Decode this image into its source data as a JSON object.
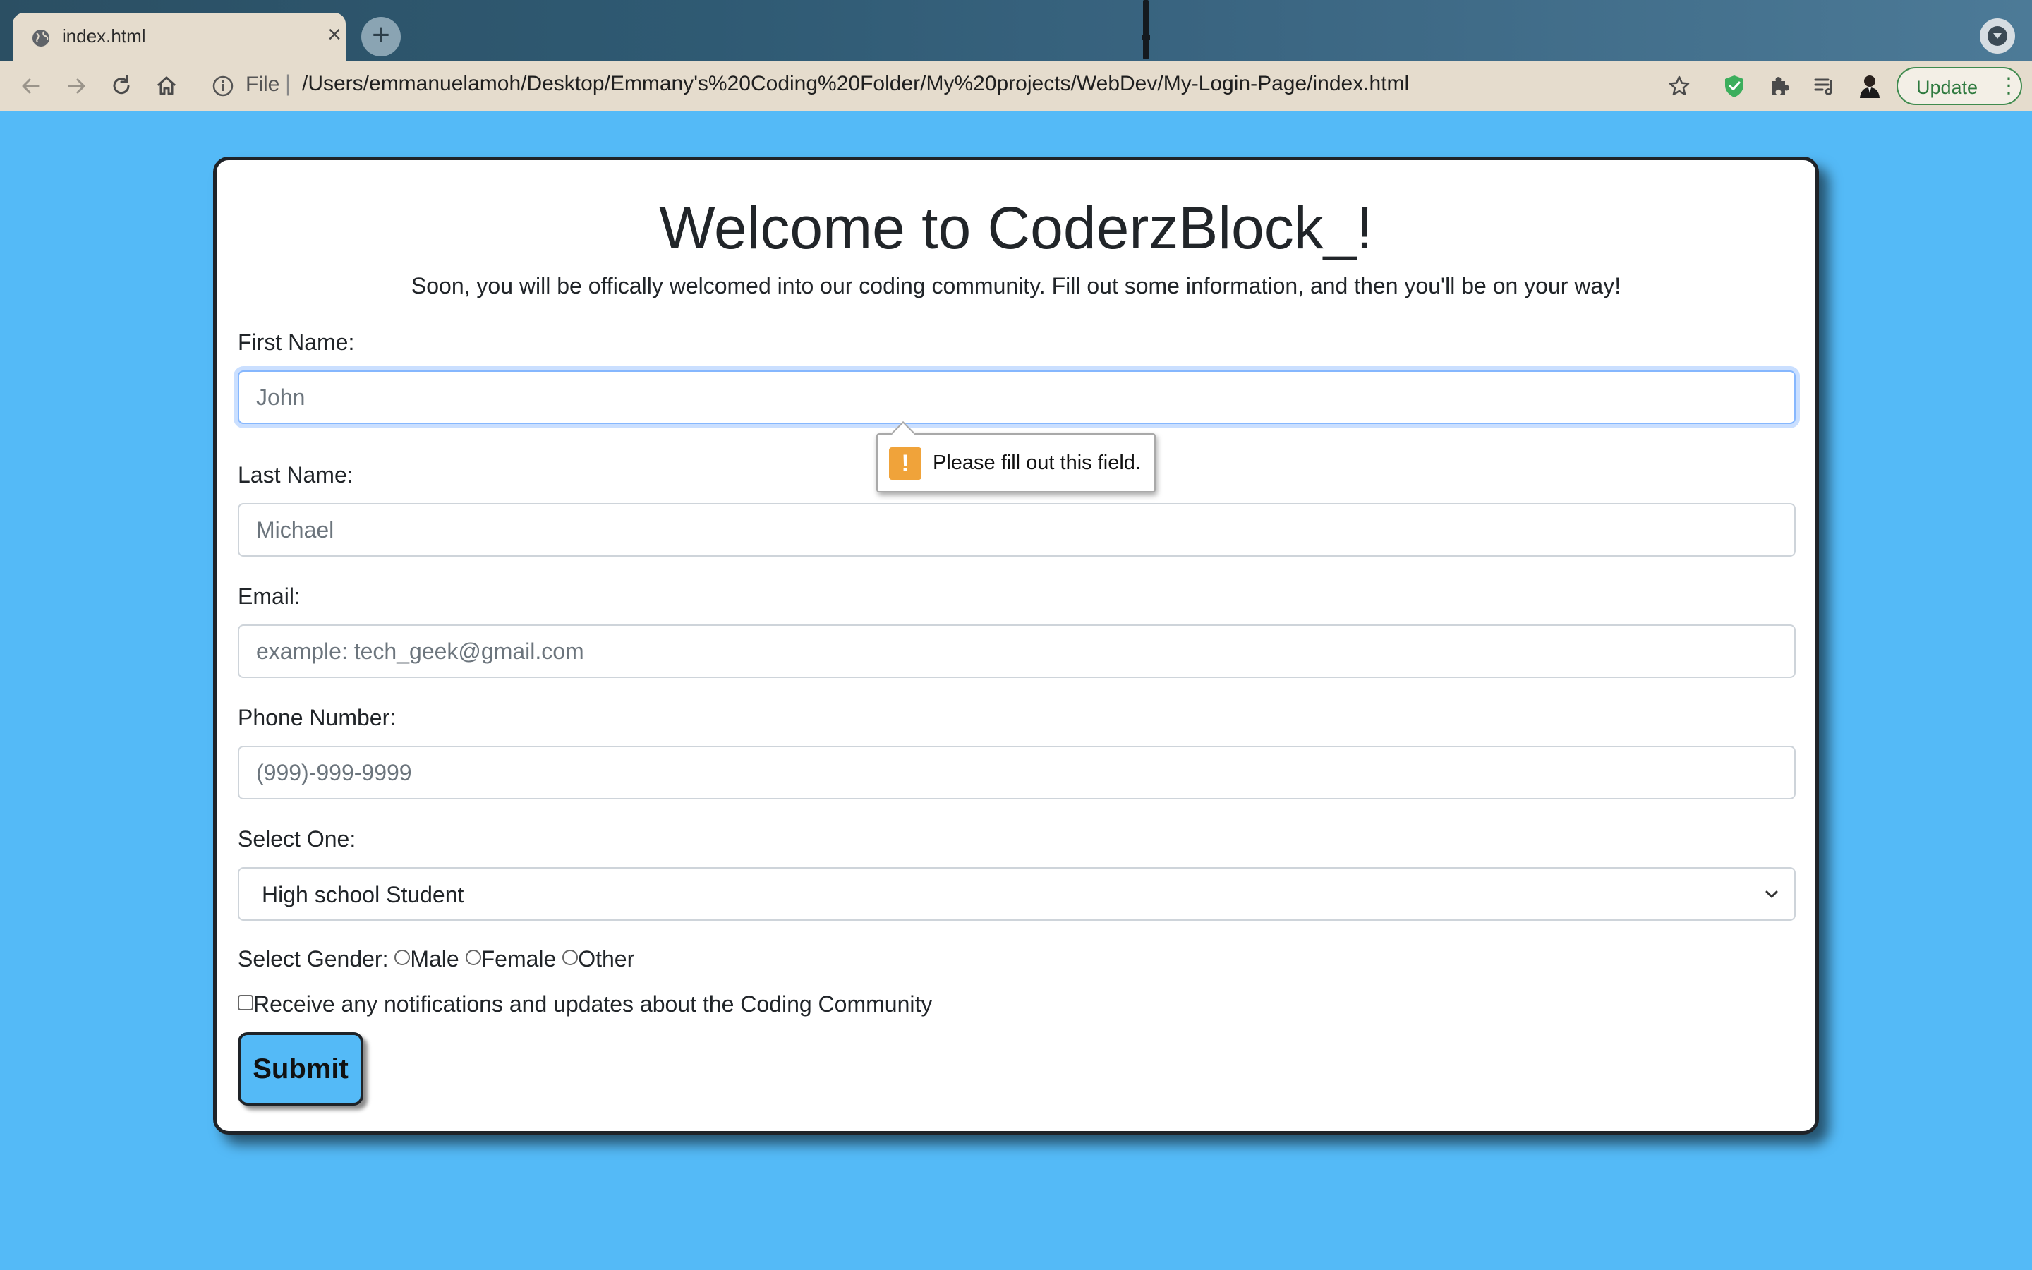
{
  "browser": {
    "tab": {
      "title": "index.html",
      "close_glyph": "×",
      "favicon": "globe-icon"
    },
    "new_tab_glyph": "+",
    "address": {
      "scheme": "File",
      "separator": "|",
      "url": "/Users/emmanuelamoh/Desktop/Emmany's%20Coding%20Folder/My%20projects/WebDev/My-Login-Page/index.html"
    },
    "update_label": "Update",
    "menu_glyph": "⋮",
    "icons": [
      "back-icon",
      "forward-icon",
      "reload-icon",
      "home-icon",
      "info-icon",
      "bookmark-star-icon",
      "shield-extension-icon",
      "puzzle-extensions-icon",
      "reading-list-icon",
      "profile-avatar-icon",
      "tab-search-icon"
    ]
  },
  "page": {
    "title": "Welcome to CoderzBlock_!",
    "subtitle": "Soon, you will be offically welcomed into our coding community. Fill out some information, and then you'll be on your way!",
    "fields": {
      "first_name": {
        "label": "First Name:",
        "placeholder": "John"
      },
      "last_name": {
        "label": "Last Name:",
        "placeholder": "Michael"
      },
      "email": {
        "label": "Email:",
        "placeholder": "example: tech_geek@gmail.com"
      },
      "phone": {
        "label": "Phone Number:",
        "placeholder": "(999)-999-9999"
      }
    },
    "select": {
      "label": "Select One:",
      "value": "High school Student"
    },
    "gender": {
      "label": "Select Gender:",
      "options": [
        "Male",
        "Female",
        "Other"
      ]
    },
    "notifications_label": "Receive any notifications and updates about the Coding Community",
    "submit_label": "Submit",
    "validation_message": "Please fill out this field.",
    "validation_icon_glyph": "!"
  },
  "colors": {
    "page_background": "#54baf7",
    "submit_background": "#54baf7",
    "warning_icon": "#f0a33a",
    "update_green": "#2f7a3f"
  }
}
